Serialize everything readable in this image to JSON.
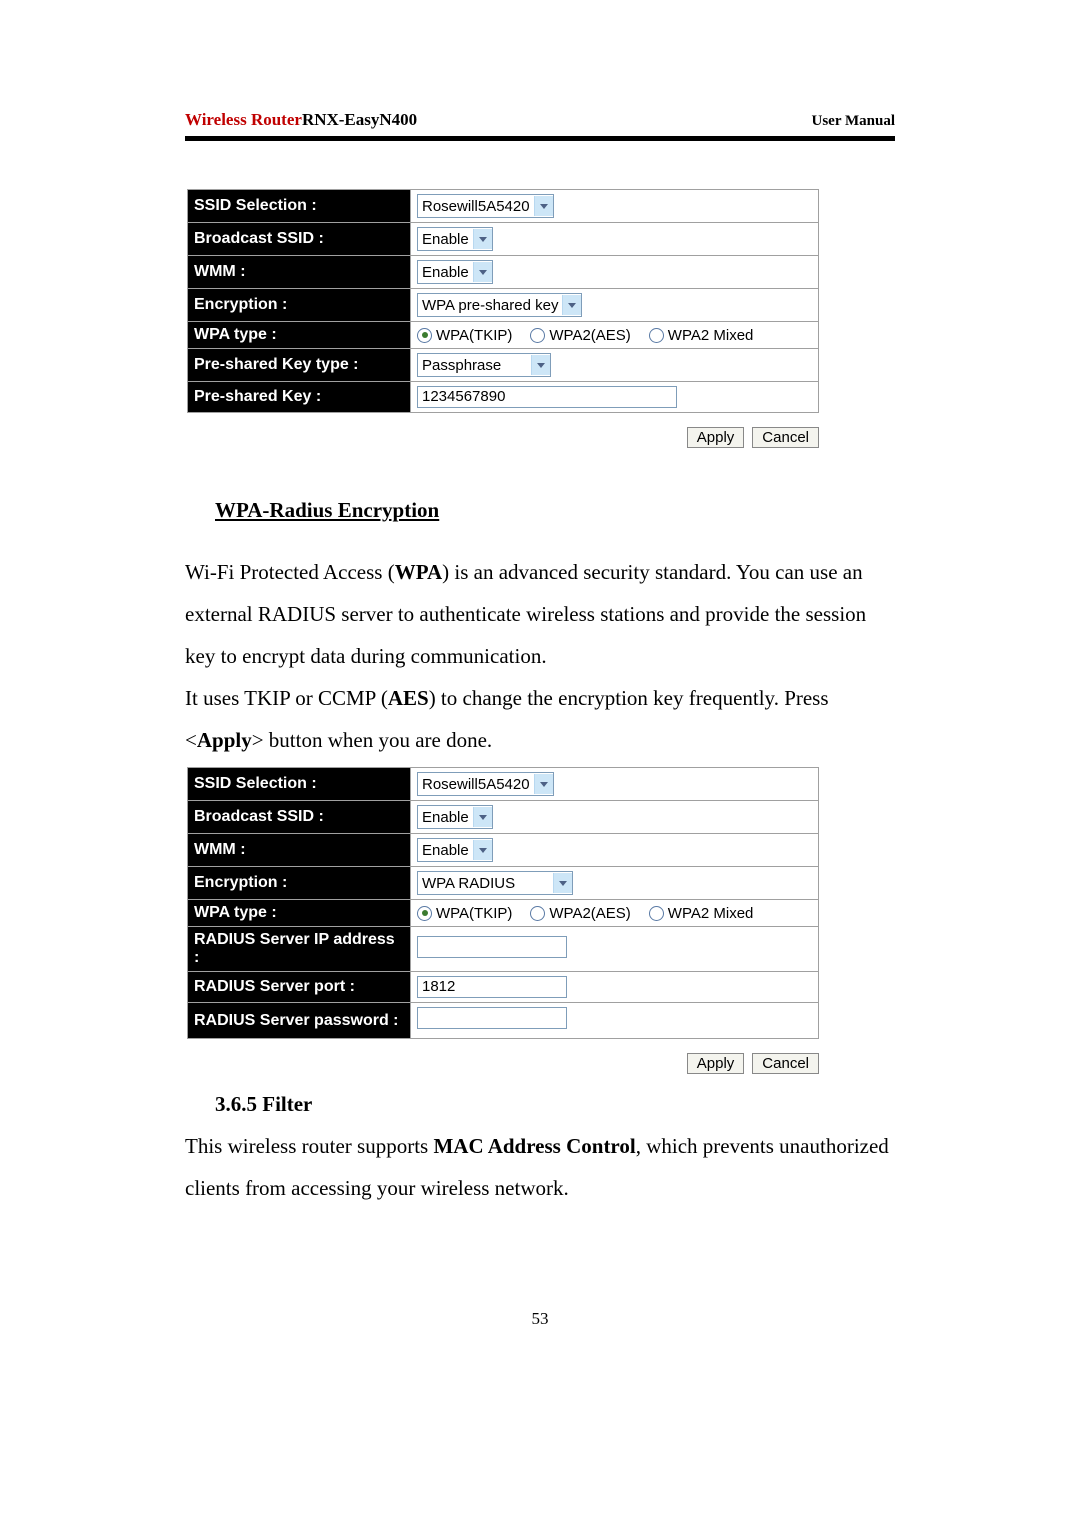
{
  "header": {
    "brand": "Wireless Router",
    "model": "RNX-EasyN400",
    "right": "User Manual"
  },
  "table1": {
    "rows": {
      "ssid_sel": {
        "label": "SSID Selection :",
        "value": "Rosewill5A5420"
      },
      "broadcast": {
        "label": "Broadcast SSID :",
        "value": "Enable"
      },
      "wmm": {
        "label": "WMM :",
        "value": "Enable"
      },
      "encryption": {
        "label": "Encryption :",
        "value": "WPA pre-shared key"
      },
      "wpa_type": {
        "label": "WPA type :",
        "opts": {
          "a": "WPA(TKIP)",
          "b": "WPA2(AES)",
          "c": "WPA2 Mixed"
        }
      },
      "psk_type": {
        "label": "Pre-shared Key type :",
        "value": "Passphrase"
      },
      "psk": {
        "label": "Pre-shared Key :",
        "value": "1234567890"
      }
    }
  },
  "btns": {
    "apply": "Apply",
    "cancel": "Cancel"
  },
  "section1": {
    "title": "WPA-Radius Encryption",
    "p1a": "Wi-Fi Protected Access (",
    "p1b": "WPA",
    "p1c": ") is an advanced security standard. You can use an external RADIUS server to authenticate wireless stations and provide the session key to encrypt data during communication.",
    "p2a": "It uses TKIP or CCMP (",
    "p2b": "AES",
    "p2c": ") to change the encryption key frequently. Press <",
    "p2d": "Apply",
    "p2e": "> button when you are done."
  },
  "table2": {
    "rows": {
      "ssid_sel": {
        "label": "SSID Selection :",
        "value": "Rosewill5A5420"
      },
      "broadcast": {
        "label": "Broadcast SSID :",
        "value": "Enable"
      },
      "wmm": {
        "label": "WMM :",
        "value": "Enable"
      },
      "encryption": {
        "label": "Encryption :",
        "value": "WPA RADIUS"
      },
      "wpa_type": {
        "label": "WPA type :",
        "opts": {
          "a": "WPA(TKIP)",
          "b": "WPA2(AES)",
          "c": "WPA2 Mixed"
        }
      },
      "radius_ip": {
        "label": "RADIUS Server IP address :",
        "value": ""
      },
      "radius_port": {
        "label": "RADIUS Server port :",
        "value": "1812"
      },
      "radius_pw": {
        "label": "RADIUS Server password :",
        "value": ""
      }
    }
  },
  "section2": {
    "title": "3.6.5 Filter",
    "p1a": "This wireless router supports ",
    "p1b": "MAC Address Control",
    "p1c": ", which prevents unauthorized clients from accessing your wireless network."
  },
  "page_num": "53"
}
